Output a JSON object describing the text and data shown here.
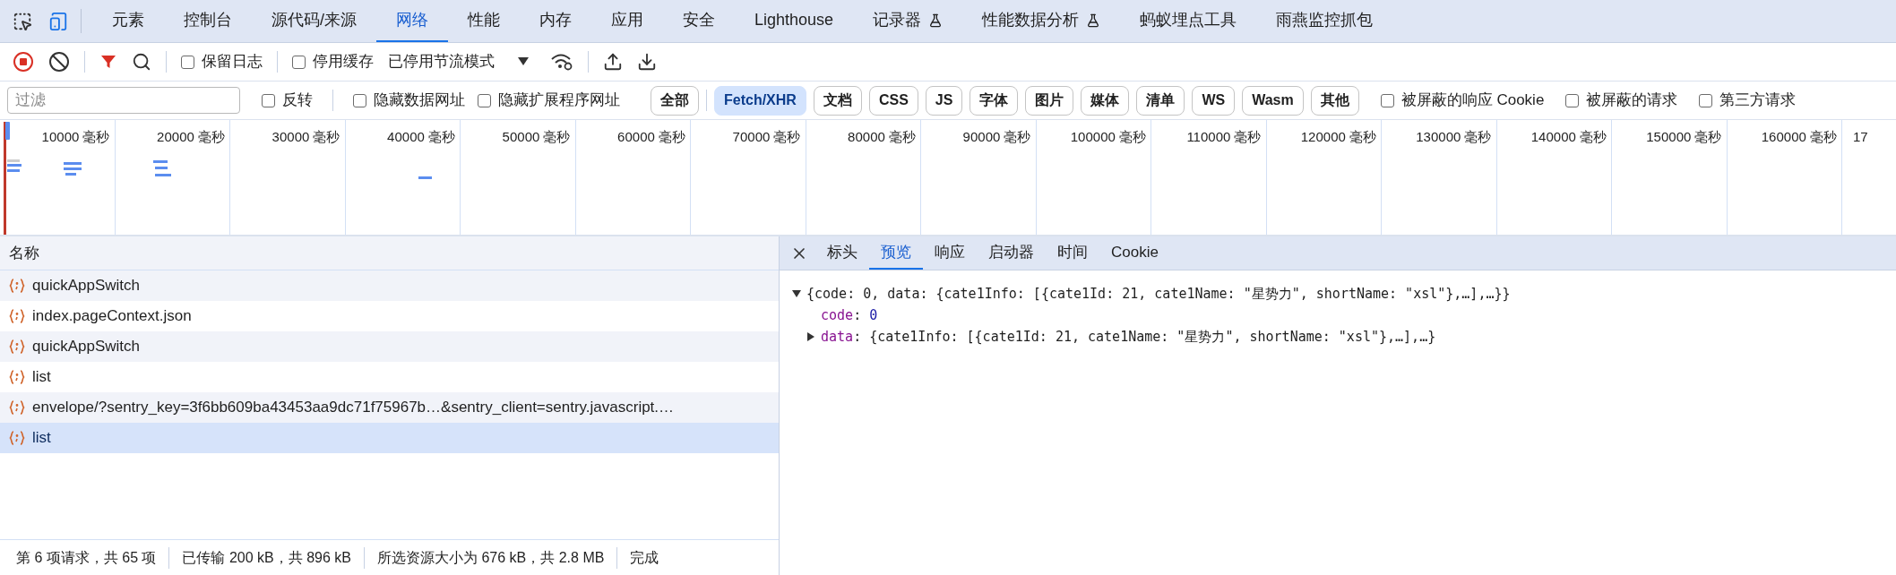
{
  "panel_tabs": [
    {
      "label": "元素",
      "selected": false,
      "experimental": false
    },
    {
      "label": "控制台",
      "selected": false,
      "experimental": false
    },
    {
      "label": "源代码/来源",
      "selected": false,
      "experimental": false
    },
    {
      "label": "网络",
      "selected": true,
      "experimental": false
    },
    {
      "label": "性能",
      "selected": false,
      "experimental": false
    },
    {
      "label": "内存",
      "selected": false,
      "experimental": false
    },
    {
      "label": "应用",
      "selected": false,
      "experimental": false
    },
    {
      "label": "安全",
      "selected": false,
      "experimental": false
    },
    {
      "label": "Lighthouse",
      "selected": false,
      "experimental": false
    },
    {
      "label": "记录器",
      "selected": false,
      "experimental": true
    },
    {
      "label": "性能数据分析",
      "selected": false,
      "experimental": true
    },
    {
      "label": "蚂蚁埋点工具",
      "selected": false,
      "experimental": false
    },
    {
      "label": "雨燕监控抓包",
      "selected": false,
      "experimental": false
    }
  ],
  "toolbar": {
    "recording": true,
    "preserve_log": {
      "label": "保留日志",
      "checked": false
    },
    "disable_cache": {
      "label": "停用缓存",
      "checked": false
    },
    "throttling": "已停用节流模式"
  },
  "filter": {
    "placeholder": "过滤",
    "options": [
      {
        "label": "反转",
        "checked": false
      },
      {
        "label": "隐藏数据网址",
        "checked": false
      },
      {
        "label": "隐藏扩展程序网址",
        "checked": false
      }
    ],
    "types": [
      {
        "label": "全部",
        "selected": false
      },
      {
        "label": "Fetch/XHR",
        "selected": true
      },
      {
        "label": "文档",
        "selected": false
      },
      {
        "label": "CSS",
        "selected": false
      },
      {
        "label": "JS",
        "selected": false
      },
      {
        "label": "字体",
        "selected": false
      },
      {
        "label": "图片",
        "selected": false
      },
      {
        "label": "媒体",
        "selected": false
      },
      {
        "label": "清单",
        "selected": false
      },
      {
        "label": "WS",
        "selected": false
      },
      {
        "label": "Wasm",
        "selected": false
      },
      {
        "label": "其他",
        "selected": false
      }
    ],
    "more_options": [
      {
        "label": "被屏蔽的响应 Cookie",
        "checked": false
      },
      {
        "label": "被屏蔽的请求",
        "checked": false
      },
      {
        "label": "第三方请求",
        "checked": false
      }
    ]
  },
  "timeline": {
    "ticks": [
      "10000 毫秒",
      "20000 毫秒",
      "30000 毫秒",
      "40000 毫秒",
      "50000 毫秒",
      "60000 毫秒",
      "70000 毫秒",
      "80000 毫秒",
      "90000 毫秒",
      "100000 毫秒",
      "110000 毫秒",
      "120000 毫秒",
      "130000 毫秒",
      "140000 毫秒",
      "150000 毫秒",
      "160000 毫秒",
      "17"
    ]
  },
  "requests": {
    "column": "名称",
    "rows": [
      {
        "name": "quickAppSwitch",
        "selected": false
      },
      {
        "name": "index.pageContext.json",
        "selected": false
      },
      {
        "name": "quickAppSwitch",
        "selected": false
      },
      {
        "name": "list",
        "selected": false
      },
      {
        "name": "envelope/?sentry_key=3f6bb609ba43453aa9dc71f75967b…&sentry_client=sentry.javascript.…",
        "selected": false
      },
      {
        "name": "list",
        "selected": true
      }
    ]
  },
  "details": {
    "tabs": [
      {
        "label": "标头",
        "selected": false
      },
      {
        "label": "预览",
        "selected": true
      },
      {
        "label": "响应",
        "selected": false
      },
      {
        "label": "启动器",
        "selected": false
      },
      {
        "label": "时间",
        "selected": false
      },
      {
        "label": "Cookie",
        "selected": false
      }
    ],
    "preview": {
      "summary": "{code: 0, data: {cate1Info: [{cate1Id: 21, cate1Name: \"星势力\", shortName: \"xsl\"},…],…}}",
      "expanded": true,
      "separator": ": ",
      "children": [
        {
          "key": "code",
          "value": "0",
          "kind": "number"
        },
        {
          "key": "data",
          "value": "{cate1Info: [{cate1Id: 21, cate1Name: \"星势力\", shortName: \"xsl\"},…],…}",
          "kind": "object",
          "expanded": false
        }
      ]
    }
  },
  "status_bar": [
    "第 6 项请求，共 65 项",
    "已传输 200 kB，共 896 kB",
    "所选资源大小为 676 kB，共 2.8 MB",
    "完成"
  ]
}
